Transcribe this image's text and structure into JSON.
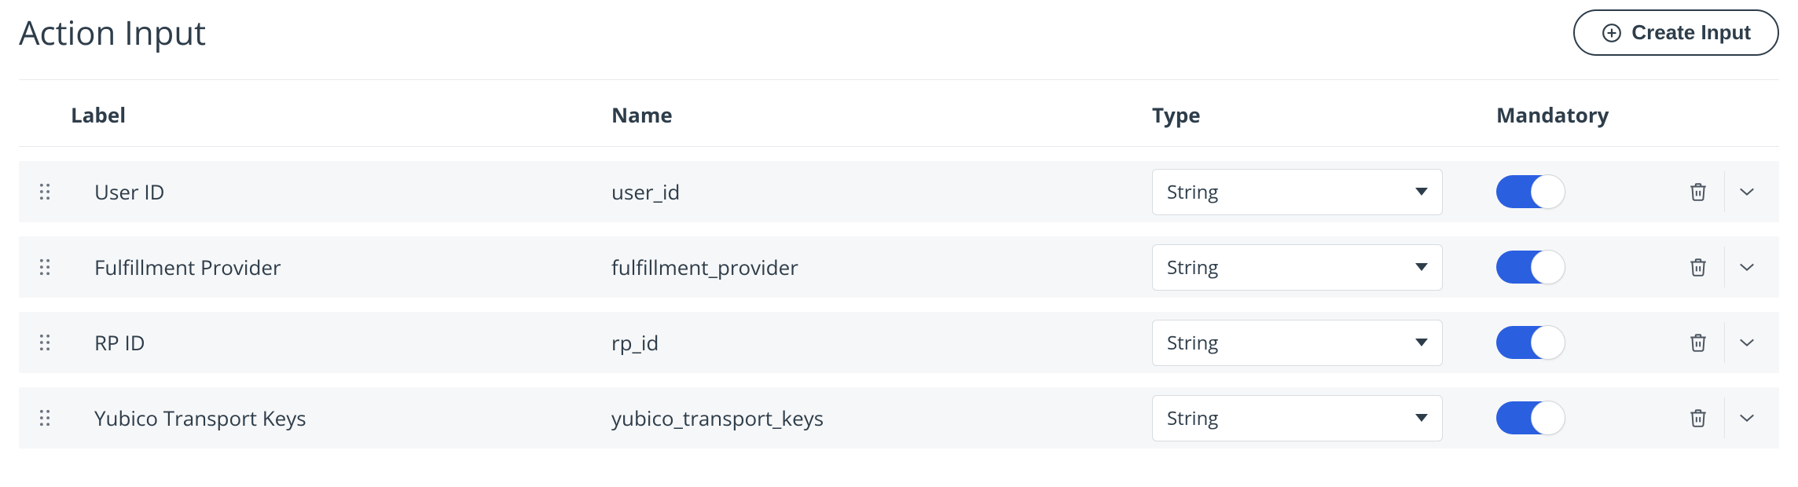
{
  "header": {
    "title": "Action Input",
    "create_label": "Create Input"
  },
  "columns": {
    "label": "Label",
    "name": "Name",
    "type": "Type",
    "mandatory": "Mandatory"
  },
  "rows": [
    {
      "label": "User ID",
      "name": "user_id",
      "type": "String",
      "mandatory": true
    },
    {
      "label": "Fulfillment Provider",
      "name": "fulfillment_provider",
      "type": "String",
      "mandatory": true
    },
    {
      "label": "RP ID",
      "name": "rp_id",
      "type": "String",
      "mandatory": true
    },
    {
      "label": "Yubico Transport Keys",
      "name": "yubico_transport_keys",
      "type": "String",
      "mandatory": true
    }
  ]
}
